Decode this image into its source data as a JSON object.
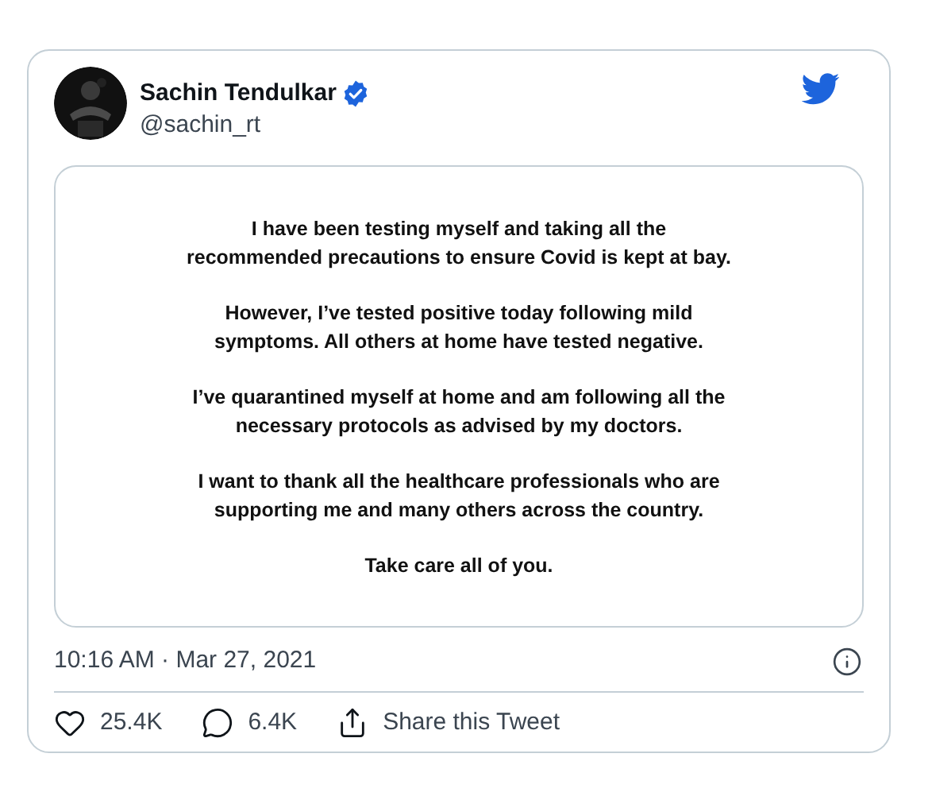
{
  "author": {
    "name": "Sachin Tendulkar",
    "verified": true,
    "handle": "@sachin_rt"
  },
  "statement": [
    "I have been testing myself and taking all the recommended precautions to ensure Covid is kept at bay.",
    "However, I’ve tested positive today following mild symptoms. All others at home have tested negative.",
    "I’ve quarantined myself at home and am following all the necessary protocols as advised by my doctors.",
    "I want to thank all the healthcare professionals who are supporting me and many others across the country.",
    "Take care all of you."
  ],
  "timestamp": "10:16 AM · Mar 27, 2021",
  "actions": [
    {
      "kind": "like",
      "label": "25.4K"
    },
    {
      "kind": "reply",
      "label": "6.4K"
    },
    {
      "kind": "share",
      "label": "Share this Tweet"
    }
  ]
}
